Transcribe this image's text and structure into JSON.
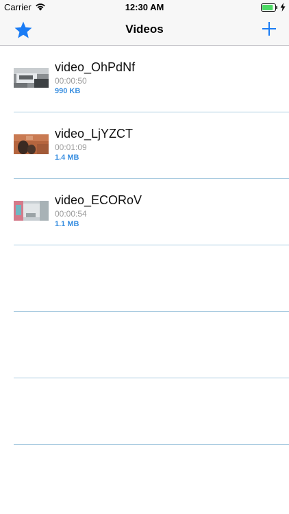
{
  "status_bar": {
    "carrier": "Carrier",
    "time": "12:30 AM",
    "battery_level": 0.85,
    "battery_color": "#4cd964",
    "icons": [
      "wifi-icon",
      "battery-icon",
      "charging-bolt-icon"
    ]
  },
  "nav": {
    "title": "Videos",
    "left_icon": "star-icon",
    "right_icon": "plus-icon",
    "accent_color": "#1a7cf5"
  },
  "videos": [
    {
      "title": "video_OhPdNf",
      "duration": "00:00:50",
      "size": "990 KB"
    },
    {
      "title": "video_LjYZCT",
      "duration": "00:01:09",
      "size": "1.4 MB"
    },
    {
      "title": "video_ECORoV",
      "duration": "00:00:54",
      "size": "1.1 MB"
    }
  ],
  "colors": {
    "size_text": "#3a8fe0",
    "duration_text": "#9b9b9b",
    "separator": "#a9cbe0"
  }
}
